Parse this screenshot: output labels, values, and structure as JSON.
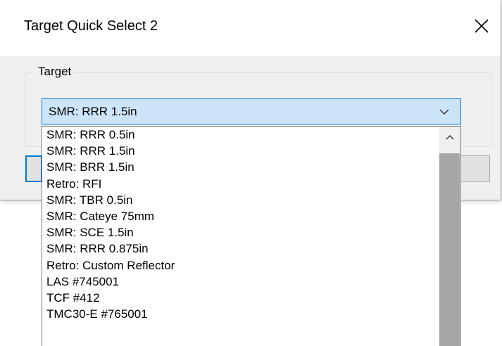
{
  "dialog": {
    "title": "Target Quick Select 2",
    "close_icon": "close-icon",
    "group": {
      "label": "Target"
    },
    "combo": {
      "selected": "SMR: RRR 1.5in",
      "arrow_icon": "chevron-down-icon"
    },
    "dropdown": {
      "items": [
        "SMR: RRR 0.5in",
        "SMR: RRR 1.5in",
        "SMR: BRR 1.5in",
        "Retro: RFI",
        "SMR: TBR 0.5in",
        "SMR: Cateye 75mm",
        "SMR: SCE 1.5in",
        "SMR: RRR 0.875in",
        "Retro: Custom Reflector",
        "LAS #745001",
        "TCF #412",
        "TMC30-E #765001"
      ],
      "scroll_up_icon": "chevron-up-icon"
    }
  },
  "colors": {
    "accent": "#0078d7",
    "combo_highlight": "#cce4f7",
    "dialog_bg": "#f0f0f0",
    "scroll_thumb": "#a6a6a6"
  }
}
